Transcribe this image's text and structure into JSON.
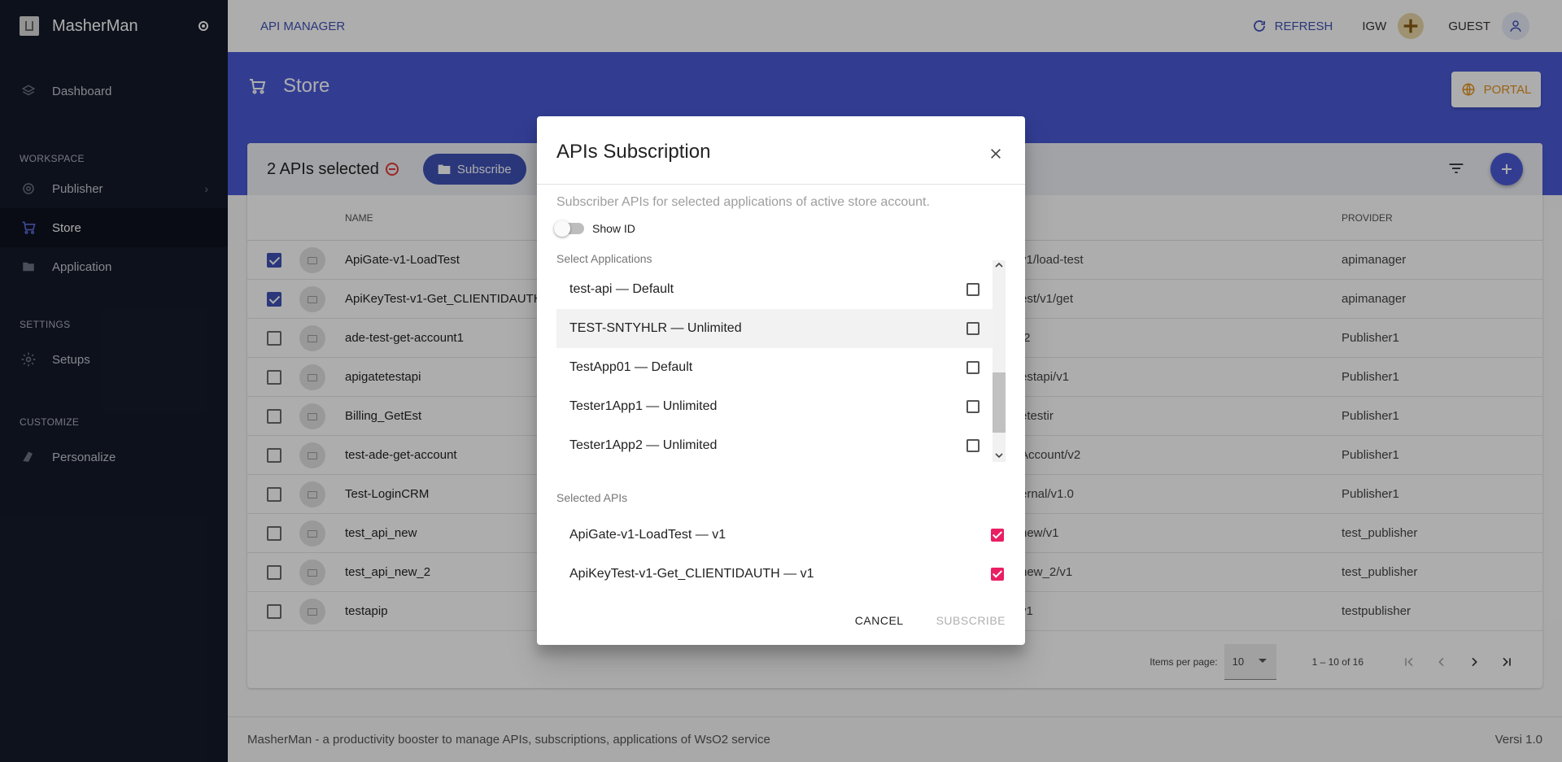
{
  "app": {
    "name": "MasherMan"
  },
  "sidebar": {
    "items": [
      {
        "label": "Dashboard"
      },
      {
        "section": "WORKSPACE"
      },
      {
        "label": "Publisher"
      },
      {
        "label": "Store"
      },
      {
        "label": "Application"
      },
      {
        "section": "SETTINGS"
      },
      {
        "label": "Setups"
      },
      {
        "section": "CUSTOMIZE"
      },
      {
        "label": "Personalize"
      }
    ]
  },
  "topbar": {
    "title": "API MANAGER",
    "refresh": "REFRESH",
    "org": "IGW",
    "user": "GUEST"
  },
  "page": {
    "title": "Store",
    "portal": "PORTAL"
  },
  "toolbar": {
    "selected": "2 APIs selected",
    "subscribe": "Subscribe"
  },
  "table": {
    "headers": {
      "name": "NAME",
      "provider": "PROVIDER"
    },
    "rows": [
      {
        "checked": true,
        "name": "ApiGate-v1-LoadTest",
        "path": "v1/load-test",
        "provider": "apimanager"
      },
      {
        "checked": true,
        "name": "ApiKeyTest-v1-Get_CLIENTIDAUTH",
        "path": "est/v1/get",
        "provider": "apimanager"
      },
      {
        "checked": false,
        "name": "ade-test-get-account1",
        "path": "/2",
        "provider": "Publisher1"
      },
      {
        "checked": false,
        "name": "apigatetestapi",
        "path": "estapi/v1",
        "provider": "Publisher1"
      },
      {
        "checked": false,
        "name": "Billing_GetEst",
        "path": "etestir",
        "provider": "Publisher1"
      },
      {
        "checked": false,
        "name": "test-ade-get-account",
        "path": "Account/v2",
        "provider": "Publisher1"
      },
      {
        "checked": false,
        "name": "Test-LoginCRM",
        "path": "ernal/v1.0",
        "provider": "Publisher1"
      },
      {
        "checked": false,
        "name": "test_api_new",
        "path": "new/v1",
        "provider": "test_publisher"
      },
      {
        "checked": false,
        "name": "test_api_new_2",
        "path": "new_2/v1",
        "provider": "test_publisher"
      },
      {
        "checked": false,
        "name": "testapip",
        "path": "v1",
        "provider": "testpublisher"
      }
    ]
  },
  "pager": {
    "items_per_page_label": "Items per page:",
    "items_per_page": "10",
    "range": "1 – 10 of 16"
  },
  "footer": {
    "text": "MasherMan - a productivity booster to manage APIs, subscriptions, applications of WsO2 service",
    "version": "Versi 1.0"
  },
  "dialog": {
    "title": "APIs Subscription",
    "description": "Subscriber APIs for selected applications of active store account.",
    "show_id": "Show ID",
    "select_apps_label": "Select Applications",
    "apps": [
      {
        "label": "test-api — Default"
      },
      {
        "label": "TEST-SNTYHLR — Unlimited"
      },
      {
        "label": "TestApp01 — Default"
      },
      {
        "label": "Tester1App1 — Unlimited"
      },
      {
        "label": "Tester1App2 — Unlimited"
      }
    ],
    "selected_apis_label": "Selected APIs",
    "selected_apis": [
      {
        "label": "ApiGate-v1-LoadTest — v1"
      },
      {
        "label": "ApiKeyTest-v1-Get_CLIENTIDAUTH — v1"
      }
    ],
    "cancel": "CANCEL",
    "subscribe": "SUBSCRIBE"
  }
}
